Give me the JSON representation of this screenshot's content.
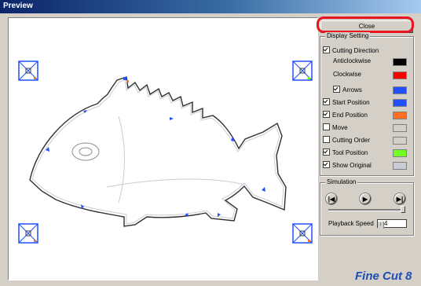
{
  "window": {
    "title": "Preview"
  },
  "close_button": {
    "label": "Close"
  },
  "display_setting": {
    "legend": "Display Setting",
    "cutting_direction": {
      "label": "Cutting Direction",
      "checked": true
    },
    "anticlockwise": {
      "label": "Anticlockwise",
      "color": "#000000"
    },
    "clockwise": {
      "label": "Clockwise",
      "color": "#ff0000"
    },
    "arrows": {
      "label": "Arrows",
      "checked": true,
      "color": "#2050ff"
    },
    "start_position": {
      "label": "Start Position",
      "checked": true,
      "color": "#2050ff"
    },
    "end_position": {
      "label": "End Position",
      "checked": true,
      "color": "#ff7020"
    },
    "move": {
      "label": "Move",
      "checked": false,
      "color": "#d4d0c8"
    },
    "cutting_order": {
      "label": "Cutting Order",
      "checked": false,
      "color": "#d4d0c8"
    },
    "tool_position": {
      "label": "Tool Position",
      "checked": true,
      "color": "#70ff20"
    },
    "show_original": {
      "label": "Show Original",
      "checked": true,
      "color": "#c8ccd4"
    }
  },
  "simulation": {
    "legend": "Simulation",
    "playback_speed_label": "Playback Speed",
    "playback_speed_value": "4"
  },
  "brand": {
    "text": "Fine Cut",
    "mark": "8"
  },
  "icons": {
    "registration_mark": "registration-mark-icon",
    "play": "play-icon",
    "skip_start": "skip-start-icon",
    "skip_end": "skip-end-icon"
  }
}
